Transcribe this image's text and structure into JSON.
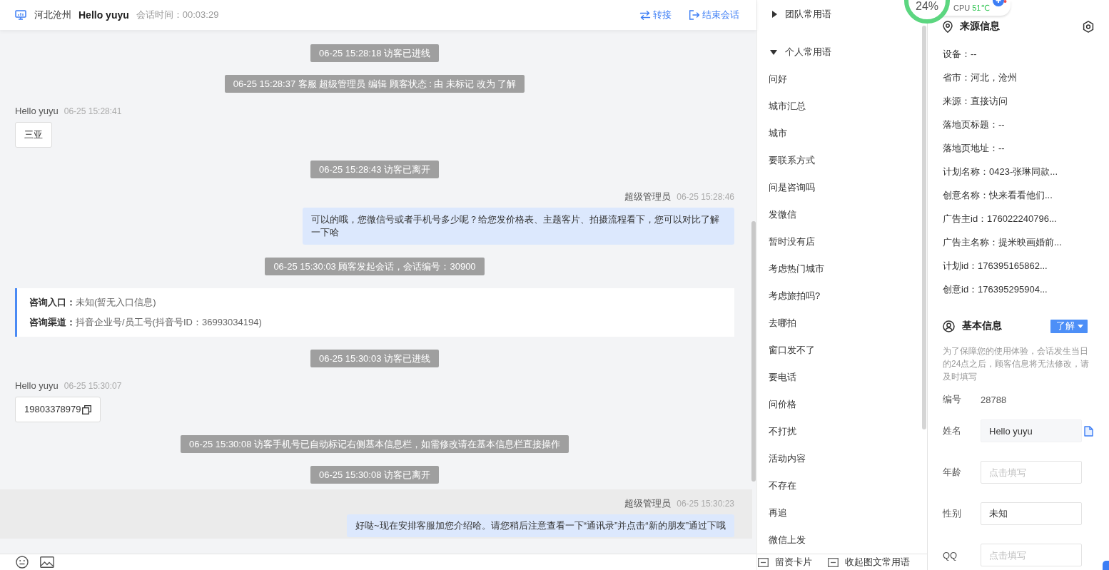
{
  "header": {
    "location": "河北沧州",
    "visitor": "Hello yuyu",
    "duration": "会话时间：00:03:29",
    "actions": [
      {
        "kind": "transfer",
        "label": "转接"
      },
      {
        "kind": "end",
        "label": "结束会话"
      }
    ]
  },
  "chat": {
    "messages": [
      {
        "kind": "system",
        "text": "06-25 15:28:18 访客已进线",
        "highlighted": false
      },
      {
        "kind": "system",
        "text": "06-25 15:28:37 客服 超级管理员 编辑 顾客状态 : 由 未标记 改为 了解",
        "highlighted": false
      },
      {
        "kind": "visitor",
        "sender": "Hello yuyu",
        "time": "06-25 15:28:41",
        "text": "三亚",
        "copyable": false,
        "highlighted": false
      },
      {
        "kind": "system",
        "text": "06-25 15:28:43 访客已离开",
        "highlighted": false
      },
      {
        "kind": "agent",
        "sender": "超级管理员",
        "time": "06-25 15:28:46",
        "text": "可以的哦，您微信号或者手机号多少呢？给您发价格表、主题客片、拍摄流程看下，您可以对比了解一下哈",
        "highlighted": false
      },
      {
        "kind": "system",
        "text": "06-25 15:30:03 顾客发起会话，会话编号：30900",
        "highlighted": false
      },
      {
        "kind": "info_card",
        "rows": [
          {
            "label": "咨询入口：",
            "value": "未知(暂无入口信息)"
          },
          {
            "label": "咨询渠道：",
            "value": "抖音企业号/员工号(抖音号ID：36993034194)"
          }
        ],
        "highlighted": false
      },
      {
        "kind": "system",
        "text": "06-25 15:30:03 访客已进线",
        "highlighted": false
      },
      {
        "kind": "visitor",
        "sender": "Hello yuyu",
        "time": "06-25 15:30:07",
        "text": "19803378979",
        "copyable": true,
        "highlighted": false
      },
      {
        "kind": "system",
        "text": "06-25 15:30:08 访客手机号已自动标记右侧基本信息栏，如需修改请在基本信息栏直接操作",
        "highlighted": false
      },
      {
        "kind": "system",
        "text": "06-25 15:30:08 访客已离开",
        "highlighted": false
      },
      {
        "kind": "agent",
        "sender": "超级管理员",
        "time": "06-25 15:30:23",
        "text": "好哒~现在安排客服加您介绍哈。请您稍后注意查看一下“通讯录”并点击“新的朋友”通过下哦",
        "highlighted": true
      }
    ]
  },
  "phrases": {
    "groups": [
      {
        "title": "团队常用语",
        "expanded": false
      },
      {
        "title": "个人常用语",
        "expanded": true,
        "items": [
          "问好",
          "城市汇总",
          "城市",
          "要联系方式",
          "问是咨询吗",
          "发微信",
          "暂时没有店",
          "考虑热门城市",
          "考虑旅拍吗?",
          "去哪拍",
          "窗口发不了",
          "要电话",
          "问价格",
          "不打扰",
          "活动内容",
          "不存在",
          "再追",
          "微信上发"
        ]
      }
    ],
    "footer": [
      {
        "label": "留资卡片"
      },
      {
        "label": "收起图文常用语"
      }
    ]
  },
  "source_info": {
    "title": "来源信息",
    "rows": [
      "设备：--",
      "省市：河北，沧州",
      "来源：直接访问",
      "落地页标题：--",
      "落地页地址：--",
      "计划名称：0423-张琳同款...",
      "创意名称：快来看看他们...",
      "广告主id：176022240796...",
      "广告主名称：提米映画婚前...",
      "计划id：176395165862...",
      "创意id：176395295904..."
    ]
  },
  "basic_info": {
    "title": "基本信息",
    "status": "了解",
    "note": "为了保障您的使用体验，会话发生当日的24点之后，顾客信息将无法修改，请及时填写",
    "fields": [
      {
        "kind": "text",
        "label": "编号",
        "value": "28788"
      },
      {
        "kind": "readonly",
        "label": "姓名",
        "value": "Hello yuyu"
      },
      {
        "kind": "input",
        "label": "年龄",
        "placeholder": "点击填写"
      },
      {
        "kind": "input",
        "label": "性别",
        "value": "未知"
      },
      {
        "kind": "input",
        "label": "QQ",
        "placeholder": "点击填写"
      }
    ]
  },
  "system_monitor": {
    "usage": "24%",
    "cpu_label": "CPU",
    "cpu_temp": "51℃"
  }
}
